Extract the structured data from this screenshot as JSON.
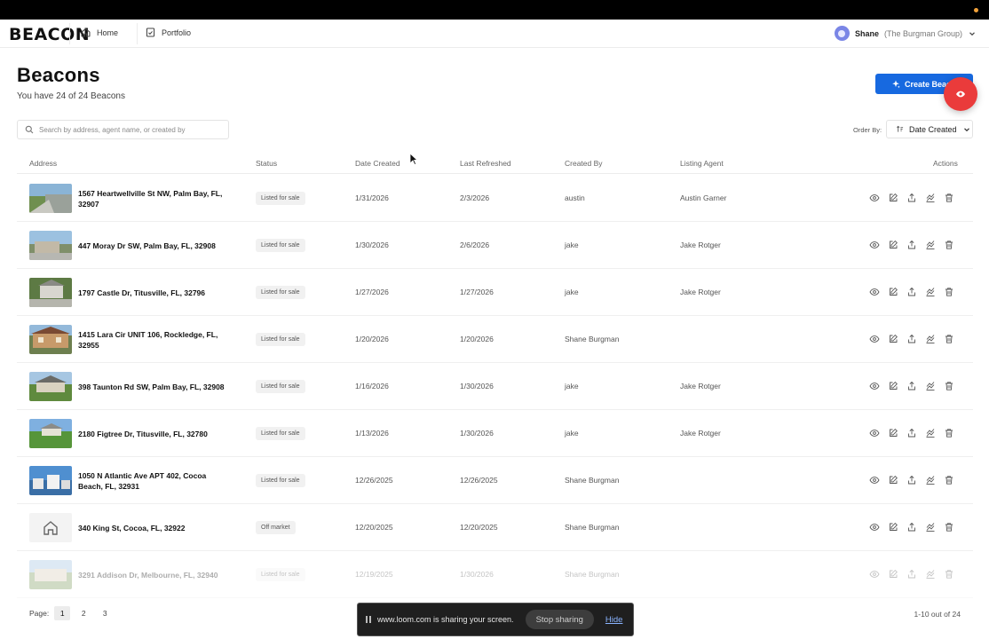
{
  "app": {
    "logo": "BEACON"
  },
  "nav": {
    "home_label": "Home",
    "portfolio_label": "Portfolio"
  },
  "user": {
    "name": "Shane",
    "org": "(The Burgman Group)"
  },
  "page": {
    "title": "Beacons",
    "subtitle": "You have 24 of 24 Beacons",
    "create_label": "Create Beacon"
  },
  "search": {
    "placeholder": "Search by address, agent name, or created by"
  },
  "order": {
    "label": "Order By:",
    "value": "Date Created"
  },
  "table": {
    "headers": [
      "Address",
      "Status",
      "Date Created",
      "Last Refreshed",
      "Created By",
      "Listing Agent",
      "Actions"
    ],
    "rows": [
      {
        "address": "1567 Heartwellville St NW, Palm Bay, FL, 32907",
        "status": "Listed for sale",
        "date_created": "1/31/2026",
        "last_refreshed": "2/3/2026",
        "created_by": "austin",
        "listing_agent": "Austin Garner",
        "thumb": "photo"
      },
      {
        "address": "447 Moray Dr SW, Palm Bay, FL, 32908",
        "status": "Listed for sale",
        "date_created": "1/30/2026",
        "last_refreshed": "2/6/2026",
        "created_by": "jake",
        "listing_agent": "Jake Rotger",
        "thumb": "photo"
      },
      {
        "address": "1797 Castle Dr, Titusville, FL, 32796",
        "status": "Listed for sale",
        "date_created": "1/27/2026",
        "last_refreshed": "1/27/2026",
        "created_by": "jake",
        "listing_agent": "Jake Rotger",
        "thumb": "photo"
      },
      {
        "address": "1415 Lara Cir UNIT 106, Rockledge, FL, 32955",
        "status": "Listed for sale",
        "date_created": "1/20/2026",
        "last_refreshed": "1/20/2026",
        "created_by": "Shane Burgman",
        "listing_agent": "",
        "thumb": "photo"
      },
      {
        "address": "398 Taunton Rd SW, Palm Bay, FL, 32908",
        "status": "Listed for sale",
        "date_created": "1/16/2026",
        "last_refreshed": "1/30/2026",
        "created_by": "jake",
        "listing_agent": "Jake Rotger",
        "thumb": "photo"
      },
      {
        "address": "2180 Figtree Dr, Titusville, FL, 32780",
        "status": "Listed for sale",
        "date_created": "1/13/2026",
        "last_refreshed": "1/30/2026",
        "created_by": "jake",
        "listing_agent": "Jake Rotger",
        "thumb": "photo"
      },
      {
        "address": "1050 N Atlantic Ave APT 402, Cocoa Beach, FL, 32931",
        "status": "Listed for sale",
        "date_created": "12/26/2025",
        "last_refreshed": "12/26/2025",
        "created_by": "Shane Burgman",
        "listing_agent": "",
        "thumb": "photo"
      },
      {
        "address": "340 King St, Cocoa, FL, 32922",
        "status": "Off market",
        "date_created": "12/20/2025",
        "last_refreshed": "12/20/2025",
        "created_by": "Shane Burgman",
        "listing_agent": "",
        "thumb": "placeholder"
      },
      {
        "address": "3291 Addison Dr, Melbourne, FL, 32940",
        "status": "Listed for sale",
        "date_created": "12/19/2025",
        "last_refreshed": "1/30/2026",
        "created_by": "Shane Burgman",
        "listing_agent": "",
        "thumb": "photo"
      }
    ]
  },
  "pagination": {
    "label": "Page:",
    "pages": [
      "1",
      "2",
      "3"
    ],
    "current": "1",
    "count_text": "1-10 out of 24"
  },
  "share_banner": {
    "text": "www.loom.com is sharing your screen.",
    "stop_label": "Stop sharing",
    "hide_label": "Hide"
  },
  "colors": {
    "primary": "#1769e0",
    "fab": "#ea3b3b",
    "status_bg": "#f1f1f1"
  },
  "icons": [
    "home-icon",
    "portfolio-icon",
    "chevron-down-icon",
    "sparkle-icon",
    "eye-icon",
    "search-icon",
    "sort-icon",
    "edit-icon",
    "share-icon",
    "refresh-icon",
    "trash-icon",
    "house-placeholder-icon",
    "pause-icon"
  ]
}
